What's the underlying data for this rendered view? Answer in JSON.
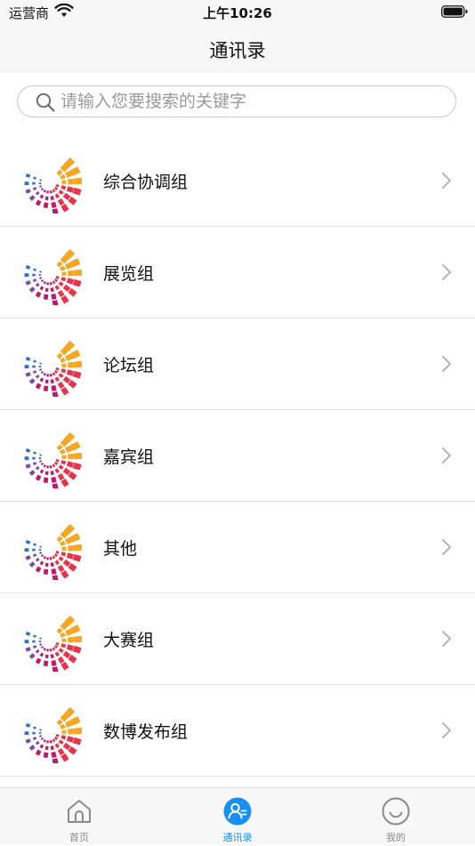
{
  "status_bar": {
    "carrier": "运营商",
    "time": "上午10:26"
  },
  "nav": {
    "title": "通讯录"
  },
  "search": {
    "placeholder": "请输入您要搜索的关键字",
    "value": ""
  },
  "groups": [
    {
      "label": "综合协调组"
    },
    {
      "label": "展览组"
    },
    {
      "label": "论坛组"
    },
    {
      "label": "嘉宾组"
    },
    {
      "label": "其他"
    },
    {
      "label": "大赛组"
    },
    {
      "label": "数博发布组"
    }
  ],
  "tabs": [
    {
      "label": "首页",
      "icon": "home-icon",
      "active": false
    },
    {
      "label": "通讯录",
      "icon": "contacts-icon",
      "active": true
    },
    {
      "label": "我的",
      "icon": "smile-icon",
      "active": false
    }
  ],
  "colors": {
    "accent": "#1a8ff2",
    "inactive": "#8a8a8a",
    "logo_orange": "#f5a623",
    "logo_red": "#e8334a",
    "logo_magenta": "#c2186b",
    "logo_purple": "#7b4ba8",
    "logo_blue": "#2f6fc4"
  }
}
